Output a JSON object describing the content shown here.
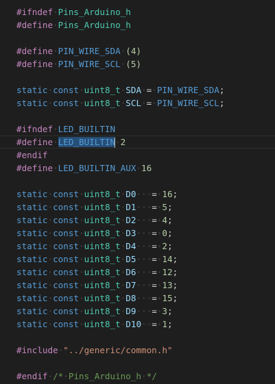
{
  "colors": {
    "background": "#1e1e1e",
    "preprocessor": "#c586c0",
    "keyword": "#569cd6",
    "type": "#4ec9b0",
    "macro": "#569cd6",
    "variable": "#9cdcfe",
    "number": "#b5cea8",
    "string": "#ce9178",
    "comment": "#6a9955"
  },
  "editor": {
    "lines": [
      [
        [
          "pre",
          "#ifndef"
        ],
        [
          "ws",
          "·"
        ],
        [
          "type",
          "Pins_Arduino_h"
        ]
      ],
      [
        [
          "pre",
          "#define"
        ],
        [
          "ws",
          "·"
        ],
        [
          "type",
          "Pins_Arduino_h"
        ]
      ],
      [],
      [
        [
          "pre",
          "#define"
        ],
        [
          "ws",
          "·"
        ],
        [
          "mac",
          "PIN_WIRE_SDA"
        ],
        [
          "ws",
          "·"
        ],
        [
          "num",
          "(4)"
        ]
      ],
      [
        [
          "pre",
          "#define"
        ],
        [
          "ws",
          "·"
        ],
        [
          "mac",
          "PIN_WIRE_SCL"
        ],
        [
          "ws",
          "·"
        ],
        [
          "num",
          "(5)"
        ]
      ],
      [],
      [
        [
          "kw",
          "static"
        ],
        [
          "ws",
          "·"
        ],
        [
          "kw",
          "const"
        ],
        [
          "ws",
          "·"
        ],
        [
          "type",
          "uint8_t"
        ],
        [
          "ws",
          "·"
        ],
        [
          "var",
          "SDA"
        ],
        [
          "ws",
          "·"
        ],
        [
          "op",
          "="
        ],
        [
          "ws",
          "·"
        ],
        [
          "mac",
          "PIN_WIRE_SDA"
        ],
        [
          "op",
          ";"
        ]
      ],
      [
        [
          "kw",
          "static"
        ],
        [
          "ws",
          "·"
        ],
        [
          "kw",
          "const"
        ],
        [
          "ws",
          "·"
        ],
        [
          "type",
          "uint8_t"
        ],
        [
          "ws",
          "·"
        ],
        [
          "var",
          "SCL"
        ],
        [
          "ws",
          "·"
        ],
        [
          "op",
          "="
        ],
        [
          "ws",
          "·"
        ],
        [
          "mac",
          "PIN_WIRE_SCL"
        ],
        [
          "op",
          ";"
        ]
      ],
      [],
      [
        [
          "pre",
          "#ifndef"
        ],
        [
          "ws",
          "·"
        ],
        [
          "mac",
          "LED_BUILTIN"
        ]
      ],
      [
        [
          "pre",
          "#define"
        ],
        [
          "ws",
          "·"
        ],
        [
          "hl",
          "LED_BUILTIN"
        ],
        [
          "ws",
          "·"
        ],
        [
          "num",
          "2"
        ]
      ],
      [
        [
          "pre",
          "#endif"
        ]
      ],
      [
        [
          "pre",
          "#define"
        ],
        [
          "ws",
          "·"
        ],
        [
          "mac",
          "LED_BUILTIN_AUX"
        ],
        [
          "ws",
          "·"
        ],
        [
          "num",
          "16"
        ]
      ],
      [],
      [
        [
          "kw",
          "static"
        ],
        [
          "ws",
          "·"
        ],
        [
          "kw",
          "const"
        ],
        [
          "ws",
          "·"
        ],
        [
          "type",
          "uint8_t"
        ],
        [
          "ws",
          "·"
        ],
        [
          "var",
          "D0"
        ],
        [
          "ws",
          "···"
        ],
        [
          "op",
          "="
        ],
        [
          "ws",
          "·"
        ],
        [
          "num",
          "16"
        ],
        [
          "op",
          ";"
        ]
      ],
      [
        [
          "kw",
          "static"
        ],
        [
          "ws",
          "·"
        ],
        [
          "kw",
          "const"
        ],
        [
          "ws",
          "·"
        ],
        [
          "type",
          "uint8_t"
        ],
        [
          "ws",
          "·"
        ],
        [
          "var",
          "D1"
        ],
        [
          "ws",
          "···"
        ],
        [
          "op",
          "="
        ],
        [
          "ws",
          "·"
        ],
        [
          "num",
          "5"
        ],
        [
          "op",
          ";"
        ]
      ],
      [
        [
          "kw",
          "static"
        ],
        [
          "ws",
          "·"
        ],
        [
          "kw",
          "const"
        ],
        [
          "ws",
          "·"
        ],
        [
          "type",
          "uint8_t"
        ],
        [
          "ws",
          "·"
        ],
        [
          "var",
          "D2"
        ],
        [
          "ws",
          "···"
        ],
        [
          "op",
          "="
        ],
        [
          "ws",
          "·"
        ],
        [
          "num",
          "4"
        ],
        [
          "op",
          ";"
        ]
      ],
      [
        [
          "kw",
          "static"
        ],
        [
          "ws",
          "·"
        ],
        [
          "kw",
          "const"
        ],
        [
          "ws",
          "·"
        ],
        [
          "type",
          "uint8_t"
        ],
        [
          "ws",
          "·"
        ],
        [
          "var",
          "D3"
        ],
        [
          "ws",
          "···"
        ],
        [
          "op",
          "="
        ],
        [
          "ws",
          "·"
        ],
        [
          "num",
          "0"
        ],
        [
          "op",
          ";"
        ]
      ],
      [
        [
          "kw",
          "static"
        ],
        [
          "ws",
          "·"
        ],
        [
          "kw",
          "const"
        ],
        [
          "ws",
          "·"
        ],
        [
          "type",
          "uint8_t"
        ],
        [
          "ws",
          "·"
        ],
        [
          "var",
          "D4"
        ],
        [
          "ws",
          "···"
        ],
        [
          "op",
          "="
        ],
        [
          "ws",
          "·"
        ],
        [
          "num",
          "2"
        ],
        [
          "op",
          ";"
        ]
      ],
      [
        [
          "kw",
          "static"
        ],
        [
          "ws",
          "·"
        ],
        [
          "kw",
          "const"
        ],
        [
          "ws",
          "·"
        ],
        [
          "type",
          "uint8_t"
        ],
        [
          "ws",
          "·"
        ],
        [
          "var",
          "D5"
        ],
        [
          "ws",
          "···"
        ],
        [
          "op",
          "="
        ],
        [
          "ws",
          "·"
        ],
        [
          "num",
          "14"
        ],
        [
          "op",
          ";"
        ]
      ],
      [
        [
          "kw",
          "static"
        ],
        [
          "ws",
          "·"
        ],
        [
          "kw",
          "const"
        ],
        [
          "ws",
          "·"
        ],
        [
          "type",
          "uint8_t"
        ],
        [
          "ws",
          "·"
        ],
        [
          "var",
          "D6"
        ],
        [
          "ws",
          "···"
        ],
        [
          "op",
          "="
        ],
        [
          "ws",
          "·"
        ],
        [
          "num",
          "12"
        ],
        [
          "op",
          ";"
        ]
      ],
      [
        [
          "kw",
          "static"
        ],
        [
          "ws",
          "·"
        ],
        [
          "kw",
          "const"
        ],
        [
          "ws",
          "·"
        ],
        [
          "type",
          "uint8_t"
        ],
        [
          "ws",
          "·"
        ],
        [
          "var",
          "D7"
        ],
        [
          "ws",
          "···"
        ],
        [
          "op",
          "="
        ],
        [
          "ws",
          "·"
        ],
        [
          "num",
          "13"
        ],
        [
          "op",
          ";"
        ]
      ],
      [
        [
          "kw",
          "static"
        ],
        [
          "ws",
          "·"
        ],
        [
          "kw",
          "const"
        ],
        [
          "ws",
          "·"
        ],
        [
          "type",
          "uint8_t"
        ],
        [
          "ws",
          "·"
        ],
        [
          "var",
          "D8"
        ],
        [
          "ws",
          "···"
        ],
        [
          "op",
          "="
        ],
        [
          "ws",
          "·"
        ],
        [
          "num",
          "15"
        ],
        [
          "op",
          ";"
        ]
      ],
      [
        [
          "kw",
          "static"
        ],
        [
          "ws",
          "·"
        ],
        [
          "kw",
          "const"
        ],
        [
          "ws",
          "·"
        ],
        [
          "type",
          "uint8_t"
        ],
        [
          "ws",
          "·"
        ],
        [
          "var",
          "D9"
        ],
        [
          "ws",
          "···"
        ],
        [
          "op",
          "="
        ],
        [
          "ws",
          "·"
        ],
        [
          "num",
          "3"
        ],
        [
          "op",
          ";"
        ]
      ],
      [
        [
          "kw",
          "static"
        ],
        [
          "ws",
          "·"
        ],
        [
          "kw",
          "const"
        ],
        [
          "ws",
          "·"
        ],
        [
          "type",
          "uint8_t"
        ],
        [
          "ws",
          "·"
        ],
        [
          "var",
          "D10"
        ],
        [
          "ws",
          "··"
        ],
        [
          "op",
          "="
        ],
        [
          "ws",
          "·"
        ],
        [
          "num",
          "1"
        ],
        [
          "op",
          ";"
        ]
      ],
      [],
      [
        [
          "pre",
          "#include"
        ],
        [
          "ws",
          "·"
        ],
        [
          "str",
          "\"../generic/common.h\""
        ]
      ],
      [],
      [
        [
          "pre",
          "#endif"
        ],
        [
          "ws",
          "·"
        ],
        [
          "cmt",
          "/*"
        ],
        [
          "ws",
          "·"
        ],
        [
          "cmt",
          "Pins_Arduino_h"
        ],
        [
          "ws",
          "·"
        ],
        [
          "cmt",
          "*/"
        ]
      ]
    ]
  }
}
